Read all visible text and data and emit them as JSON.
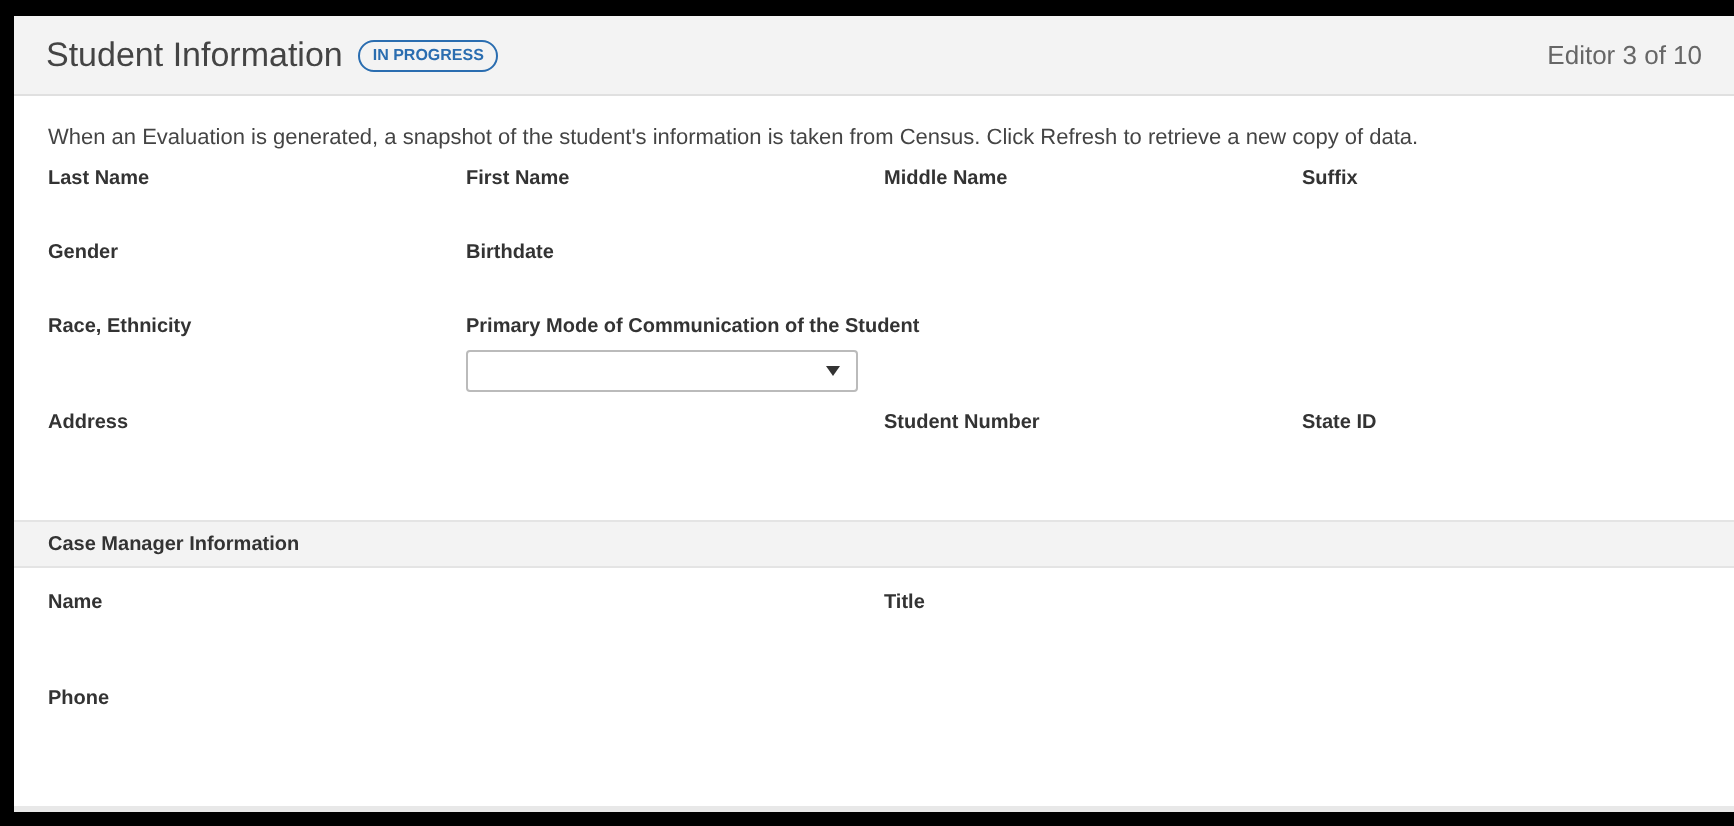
{
  "header": {
    "title": "Student Information",
    "badge": "IN PROGRESS",
    "editor_count": "Editor 3 of 10"
  },
  "note": "When an Evaluation is generated, a snapshot of the student's information is taken from Census. Click Refresh to retrieve a new copy of data.",
  "student_rows": [
    [
      {
        "kind": "label",
        "label": "Last Name"
      },
      {
        "kind": "label",
        "label": "First Name"
      },
      {
        "kind": "label",
        "label": "Middle Name"
      },
      {
        "kind": "label",
        "label": "Suffix"
      }
    ],
    [
      {
        "kind": "label",
        "label": "Gender"
      },
      {
        "kind": "label",
        "label": "Birthdate"
      }
    ],
    [
      {
        "kind": "label",
        "label": "Race, Ethnicity"
      },
      {
        "kind": "dropdown",
        "label": "Primary Mode of Communication of the Student"
      }
    ],
    [
      {
        "kind": "label",
        "label": "Address"
      },
      {
        "kind": "label",
        "label": "Student Number"
      },
      {
        "kind": "label",
        "label": "State ID"
      }
    ]
  ],
  "case_manager": {
    "title": "Case Manager Information",
    "rows": [
      [
        {
          "label": "Name"
        },
        {
          "label": "Title"
        }
      ],
      [
        {
          "label": "Phone"
        }
      ]
    ]
  }
}
